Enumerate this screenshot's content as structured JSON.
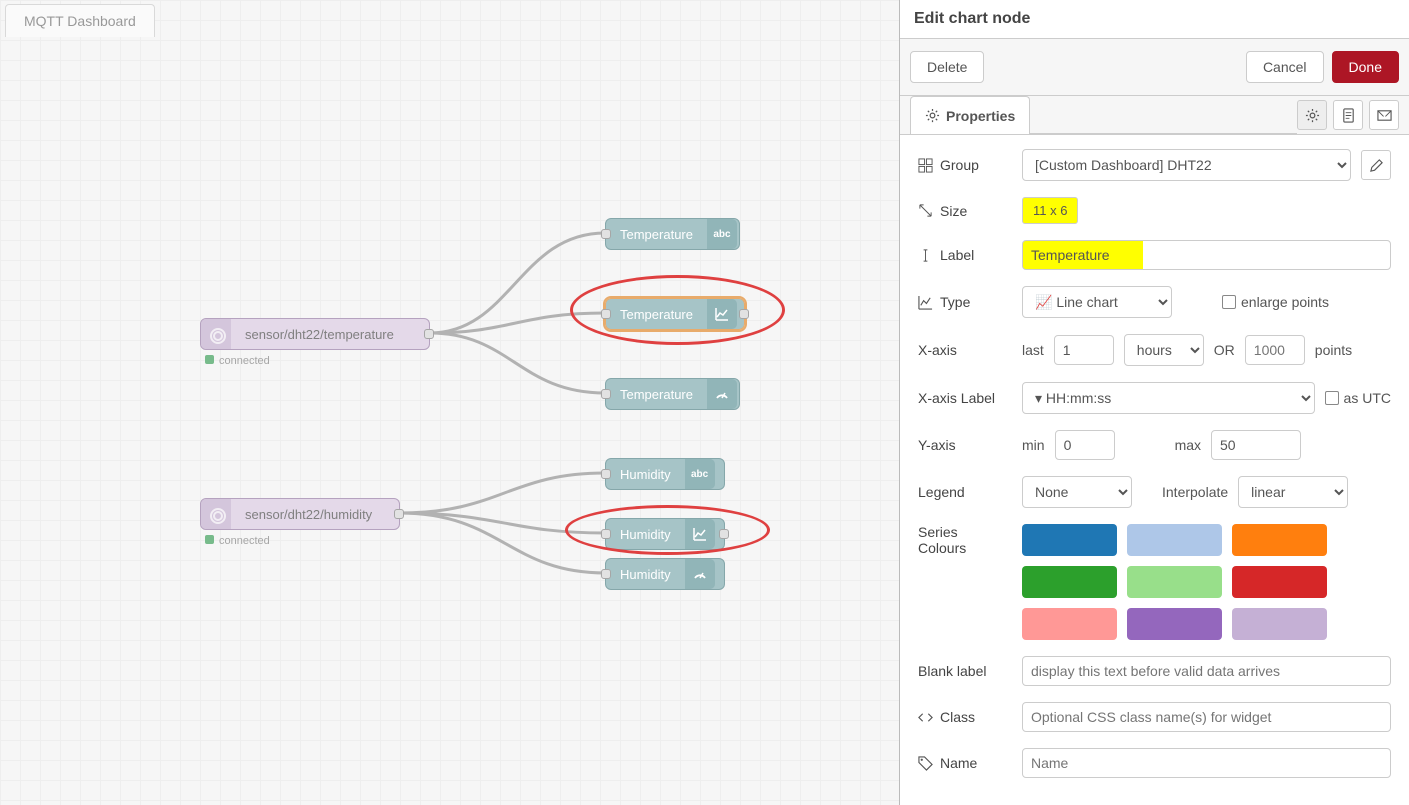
{
  "header": {
    "title": "Edit chart node",
    "delete": "Delete",
    "cancel": "Cancel",
    "done": "Done"
  },
  "tab": {
    "main": "MQTT Dashboard",
    "properties": "Properties"
  },
  "nodes": {
    "mqtt1": {
      "label": "sensor/dht22/temperature",
      "status": "connected"
    },
    "mqtt2": {
      "label": "sensor/dht22/humidity",
      "status": "connected"
    },
    "t_text": "Temperature",
    "t_chart": "Temperature",
    "t_gauge": "Temperature",
    "h_text": "Humidity",
    "h_chart": "Humidity",
    "h_gauge": "Humidity"
  },
  "form": {
    "group_label": "Group",
    "group_value": "[Custom Dashboard] DHT22",
    "size_label": "Size",
    "size_value": "11 x 6",
    "label_label": "Label",
    "label_value": "Temperature",
    "type_label": "Type",
    "type_value": "Line chart",
    "enlarge": "enlarge points",
    "xaxis_label": "X-axis",
    "xaxis_last": "last",
    "xaxis_count": "1",
    "xaxis_unit": "hours",
    "xaxis_or": "OR",
    "xaxis_pts_ph": "1000",
    "xaxis_pts": "points",
    "xlabel_label": "X-axis Label",
    "xlabel_fmt": "HH:mm:ss",
    "utc": "as UTC",
    "yaxis_label": "Y-axis",
    "ymin": "min",
    "ymin_v": "0",
    "ymax": "max",
    "ymax_v": "50",
    "legend_label": "Legend",
    "legend_v": "None",
    "interp": "Interpolate",
    "interp_v": "linear",
    "colours_label": "Series Colours",
    "blank_label": "Blank label",
    "blank_ph": "display this text before valid data arrives",
    "class_label": "Class",
    "class_ph": "Optional CSS class name(s) for widget",
    "name_label": "Name",
    "name_ph": "Name",
    "colors": [
      "#1f77b4",
      "#aec7e8",
      "#ff7f0e",
      "#2ca02c",
      "#98df8a",
      "#d62728",
      "#ff9896",
      "#9467bd",
      "#c5b0d5"
    ]
  }
}
